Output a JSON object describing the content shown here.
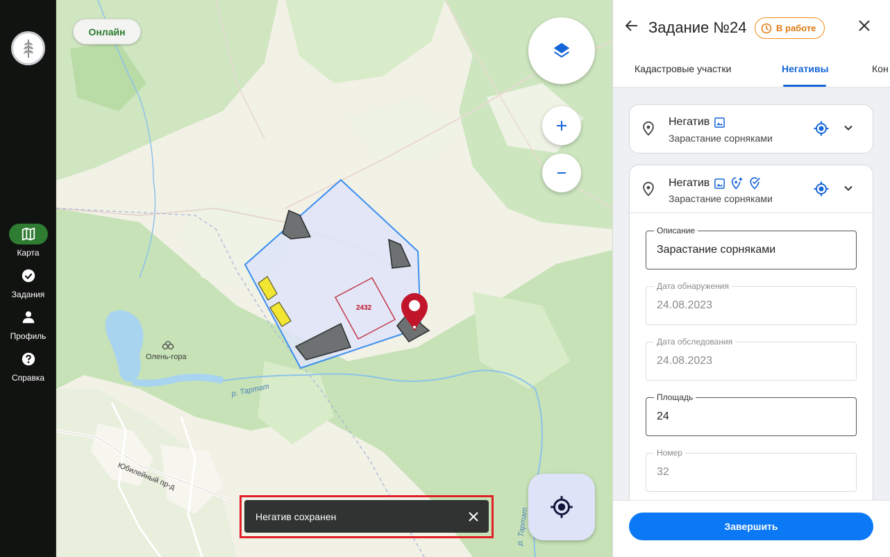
{
  "colors": {
    "rail_bg": "#111311",
    "rail_active": "#2f7d32",
    "accent_blue": "#1565d8",
    "button_blue": "#0b78f5",
    "status_orange": "#f08c1a",
    "toast_bg": "#303331",
    "highlight_red": "#e01f26",
    "polygon_fill": "#dde3f7",
    "polygon_stroke": "#3b8ff0",
    "marker_red": "#c0152a"
  },
  "rail": {
    "logo_icon": "wheat-icon",
    "items": [
      {
        "label": "Карта",
        "icon": "map-icon"
      },
      {
        "label": "Задания",
        "icon": "check-circle-icon"
      },
      {
        "label": "Профиль",
        "icon": "person-icon"
      },
      {
        "label": "Справка",
        "icon": "help-icon"
      }
    ]
  },
  "map": {
    "status_pill": "Онлайн",
    "labels": {
      "place": "Олень-гора",
      "river": "р. Тартат",
      "road": "Юбилейный пр-д",
      "river2": "р. Тартат",
      "plot_number": "2432"
    },
    "toast": {
      "message": "Негатив сохранен"
    }
  },
  "panel": {
    "title": "Задание №24",
    "status": "В работе",
    "tabs": [
      "Кадастровые участки",
      "Негативы",
      "Кон"
    ],
    "active_tab": "Негативы",
    "negatives": [
      {
        "title": "Негатив",
        "subtitle": "Зарастание сорняками"
      },
      {
        "title": "Негатив",
        "subtitle": "Зарастание сорняками"
      }
    ],
    "form": {
      "description_label": "Описание",
      "description_value": "Зарастание сорняками",
      "detected_label": "Дата обнаружения",
      "detected_value": "24.08.2023",
      "surveyed_label": "Дата обследования",
      "surveyed_value": "24.08.2023",
      "area_label": "Площадь",
      "area_value": "24",
      "number_label": "Номер",
      "number_value": "32"
    },
    "finish_button": "Завершить"
  }
}
